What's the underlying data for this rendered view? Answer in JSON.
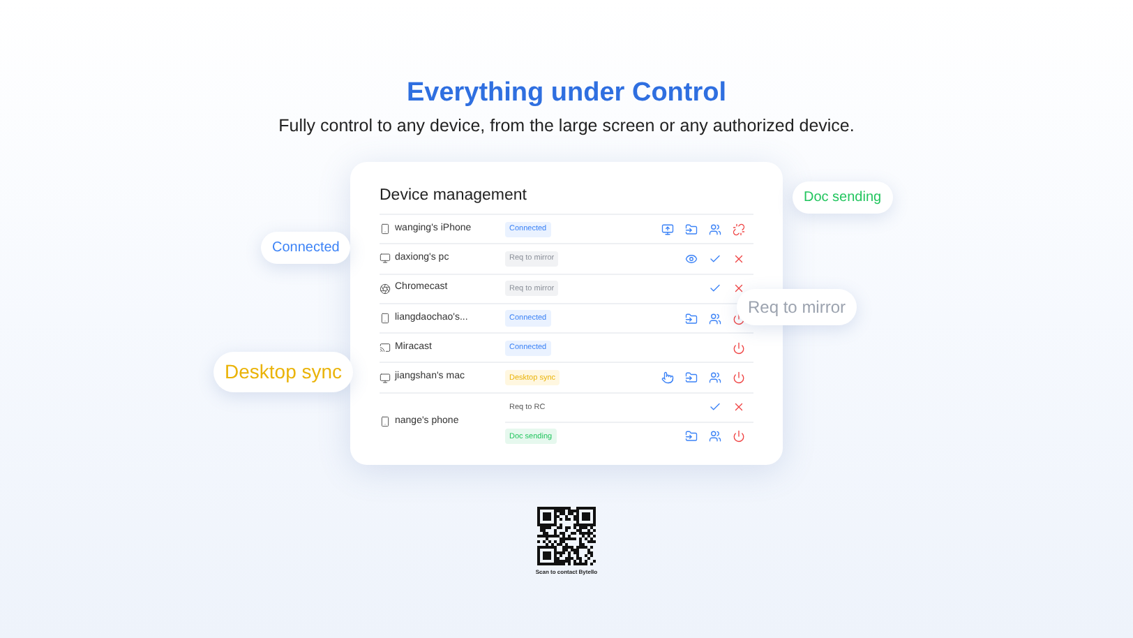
{
  "heading": "Everything under Control",
  "subheading": "Fully control to any device, from the large screen or any authorized device.",
  "panel": {
    "title": "Device management",
    "devices": [
      {
        "kind": "phone",
        "name": "wanging's iPhone",
        "states": [
          {
            "status": "Connected",
            "kind": "connected",
            "actions": [
              {
                "kind": "share"
              },
              {
                "kind": "file"
              },
              {
                "kind": "users"
              },
              {
                "kind": "unlink"
              }
            ]
          }
        ]
      },
      {
        "kind": "pc",
        "name": "daxiong's pc",
        "states": [
          {
            "status": "Req to mirror",
            "kind": "pending",
            "actions": [
              {
                "kind": "eye"
              },
              {
                "kind": "check"
              },
              {
                "kind": "close"
              }
            ]
          }
        ]
      },
      {
        "kind": "chromecast",
        "name": "Chromecast",
        "states": [
          {
            "status": "Req to mirror",
            "kind": "pending",
            "actions": [
              {
                "kind": "check"
              },
              {
                "kind": "close"
              }
            ]
          }
        ]
      },
      {
        "kind": "phone",
        "name": "liangdaochao's...",
        "states": [
          {
            "status": "Connected",
            "kind": "connected",
            "actions": [
              {
                "kind": "file"
              },
              {
                "kind": "users"
              },
              {
                "kind": "power"
              }
            ]
          }
        ]
      },
      {
        "kind": "cast",
        "name": "Miracast",
        "states": [
          {
            "status": "Connected",
            "kind": "connected",
            "actions": [
              {
                "kind": "power"
              }
            ]
          }
        ]
      },
      {
        "kind": "pc",
        "name": "jiangshan's mac",
        "states": [
          {
            "status": "Desktop sync",
            "kind": "sync",
            "actions": [
              {
                "kind": "hand"
              },
              {
                "kind": "file"
              },
              {
                "kind": "users"
              },
              {
                "kind": "power"
              }
            ]
          }
        ]
      },
      {
        "kind": "phone",
        "name": "nange's phone",
        "states": [
          {
            "status": "Req to RC",
            "kind": "request",
            "actions": [
              {
                "kind": "check"
              },
              {
                "kind": "close"
              }
            ]
          },
          {
            "status": "Doc sending",
            "kind": "sending",
            "actions": [
              {
                "kind": "file"
              },
              {
                "kind": "users"
              },
              {
                "kind": "power"
              }
            ]
          }
        ]
      }
    ]
  },
  "callouts": [
    {
      "text": "Connected",
      "kind": "connected"
    },
    {
      "text": "Desktop sync",
      "kind": "sync"
    },
    {
      "text": "Doc sending",
      "kind": "sending"
    },
    {
      "text": "Req to mirror",
      "kind": "pending"
    }
  ],
  "qr_caption": "Scan to contact Bytello"
}
